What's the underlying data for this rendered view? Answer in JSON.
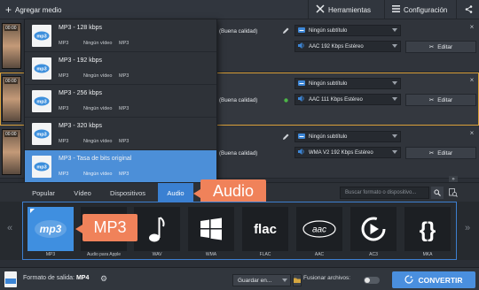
{
  "toolbar": {
    "add_media": "Agregar medio",
    "tools": "Herramientas",
    "settings": "Configuración"
  },
  "rows": [
    {
      "time": "00:00",
      "quality": "(Buena calidad)",
      "subtitle": "Ningún subtítulo",
      "audio": "AAC 192 Kbps Estéreo",
      "edit": "Editar"
    },
    {
      "time": "00:00",
      "quality": "(Buena calidad)",
      "subtitle": "Ningún subtítulo",
      "audio": "AAC 111 Kbps Estéreo",
      "edit": "Editar"
    },
    {
      "time": "00:00",
      "quality": "(Buena calidad)",
      "subtitle": "Ningún subtítulo",
      "audio": "WMA V2 192 Kbps Estéreo",
      "edit": "Editar"
    }
  ],
  "dropdown": {
    "items": [
      {
        "title": "MP3 - 128 kbps",
        "c1": "MP3",
        "c2": "Ningún vídeo",
        "c3": "MP3"
      },
      {
        "title": "MP3 - 192 kbps",
        "c1": "MP3",
        "c2": "Ningún vídeo",
        "c3": "MP3"
      },
      {
        "title": "MP3 - 256 kbps",
        "c1": "MP3",
        "c2": "Ningún vídeo",
        "c3": "MP3"
      },
      {
        "title": "MP3 - 320 kbps",
        "c1": "MP3",
        "c2": "Ningún vídeo",
        "c3": "MP3"
      },
      {
        "title": "MP3 - Tasa de bits original",
        "c1": "MP3",
        "c2": "Ningún vídeo",
        "c3": "MP3"
      }
    ]
  },
  "tabs": {
    "popular": "Popular",
    "video": "Vídeo",
    "devices": "Dispositivos",
    "audio": "Audio",
    "search_placeholder": "Buscar formato o dispositivo..."
  },
  "callouts": {
    "audio": "Audio",
    "mp3": "MP3"
  },
  "formats": [
    {
      "label": "MP3",
      "logo": "mp3"
    },
    {
      "label": "Audio para Apple",
      "logo": ""
    },
    {
      "label": "WAV",
      "logo": ""
    },
    {
      "label": "WMA",
      "logo": ""
    },
    {
      "label": "FLAC",
      "logo": "flac"
    },
    {
      "label": "AAC",
      "logo": "aac"
    },
    {
      "label": "AC3",
      "logo": ""
    },
    {
      "label": "MKA",
      "logo": ""
    }
  ],
  "bottom": {
    "output_label": "Formato de salida:",
    "output_value": "MP4",
    "save_to": "Guardar en...",
    "merge": "Fusionar archivos:",
    "convert": "CONVERTIR"
  },
  "colors": {
    "accent": "#3a80d2",
    "callout": "#f0825a",
    "highlight_border": "#d9a03a"
  }
}
